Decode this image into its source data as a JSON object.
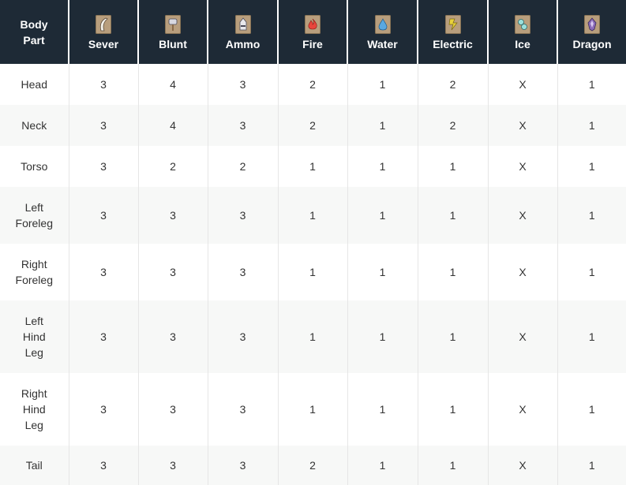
{
  "table": {
    "header": {
      "body_part_label": "Body Part",
      "columns": [
        {
          "label": "Sever",
          "icon": "sever-icon"
        },
        {
          "label": "Blunt",
          "icon": "blunt-icon"
        },
        {
          "label": "Ammo",
          "icon": "ammo-icon"
        },
        {
          "label": "Fire",
          "icon": "fire-icon"
        },
        {
          "label": "Water",
          "icon": "water-icon"
        },
        {
          "label": "Electric",
          "icon": "electric-icon"
        },
        {
          "label": "Ice",
          "icon": "ice-icon"
        },
        {
          "label": "Dragon",
          "icon": "dragon-icon"
        }
      ]
    },
    "rows": [
      {
        "part": "Head",
        "values": [
          "3",
          "4",
          "3",
          "2",
          "1",
          "2",
          "X",
          "1"
        ]
      },
      {
        "part": "Neck",
        "values": [
          "3",
          "4",
          "3",
          "2",
          "1",
          "2",
          "X",
          "1"
        ]
      },
      {
        "part": "Torso",
        "values": [
          "3",
          "2",
          "2",
          "1",
          "1",
          "1",
          "X",
          "1"
        ]
      },
      {
        "part": "Left Foreleg",
        "values": [
          "3",
          "3",
          "3",
          "1",
          "1",
          "1",
          "X",
          "1"
        ]
      },
      {
        "part": "Right Foreleg",
        "values": [
          "3",
          "3",
          "3",
          "1",
          "1",
          "1",
          "X",
          "1"
        ]
      },
      {
        "part": "Left Hind Leg",
        "values": [
          "3",
          "3",
          "3",
          "1",
          "1",
          "1",
          "X",
          "1"
        ]
      },
      {
        "part": "Right Hind Leg",
        "values": [
          "3",
          "3",
          "3",
          "1",
          "1",
          "1",
          "X",
          "1"
        ]
      },
      {
        "part": "Tail",
        "values": [
          "3",
          "3",
          "3",
          "2",
          "1",
          "1",
          "X",
          "1"
        ]
      }
    ]
  },
  "colors": {
    "header_bg": "#1e2a36",
    "header_text": "#ffffff",
    "row_alt_bg": "#f7f8f7",
    "cell_text": "#333333",
    "icon_bg": "#b89e7d"
  }
}
